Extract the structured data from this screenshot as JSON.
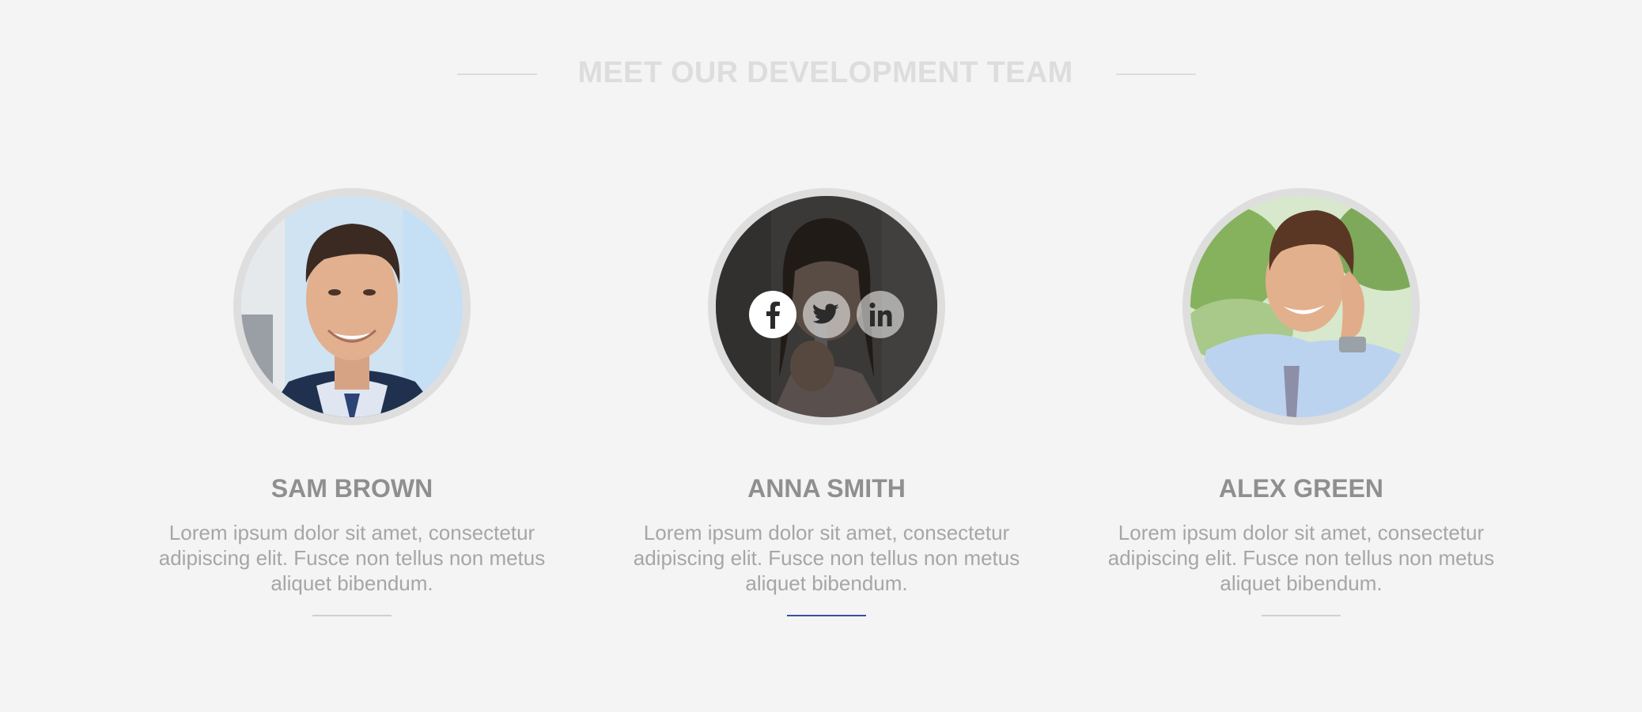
{
  "section": {
    "title": "MEET OUR DEVELOPMENT TEAM"
  },
  "members": [
    {
      "name": "SAM BROWN",
      "bio": "Lorem ipsum dolor sit amet, consectetur adipiscing elit. Fusce non tellus non metus aliquet bibendum."
    },
    {
      "name": "ANNA SMITH",
      "bio": "Lorem ipsum dolor sit amet, consectetur adipiscing elit. Fusce non tellus non metus aliquet bibendum.",
      "social": [
        "facebook-icon",
        "twitter-icon",
        "linkedin-icon"
      ]
    },
    {
      "name": "ALEX GREEN",
      "bio": "Lorem ipsum dolor sit amet, consectetur adipiscing elit. Fusce non tellus non metus aliquet bibendum."
    }
  ],
  "colors": {
    "background": "#f4f4f4",
    "title": "#dddddd",
    "name": "#8f8f8f",
    "bio": "#a6a6a6",
    "divider": "#d0d0d0",
    "active_divider": "#35529a"
  }
}
